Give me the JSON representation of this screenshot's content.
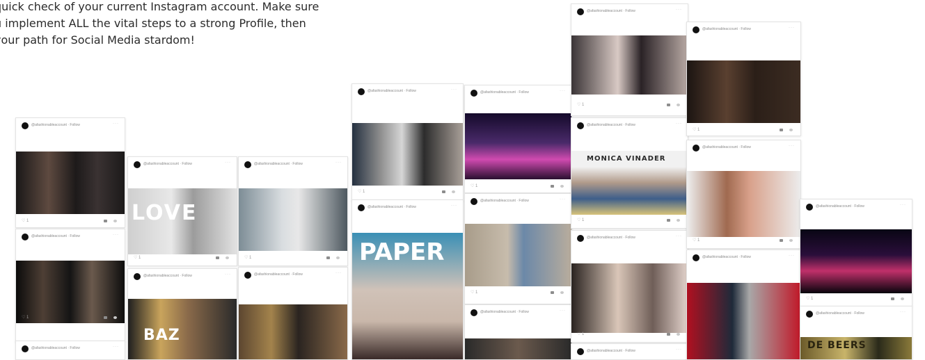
{
  "intro": {
    "line1": "quick check of your current Instagram account. Make sure",
    "line2": "u implement ALL the vital steps to a strong Profile, then",
    "line3": "your path for Social Media stardom!"
  },
  "post": {
    "handle": "@afashionableaccount · Follow",
    "more": "···",
    "likes": "♡ 1"
  },
  "overlays": {
    "love": "LOVE",
    "paper": "PAPER",
    "monica": "MONICA VINADER",
    "baz": "BAZ",
    "debeers": "DE BEERS"
  }
}
